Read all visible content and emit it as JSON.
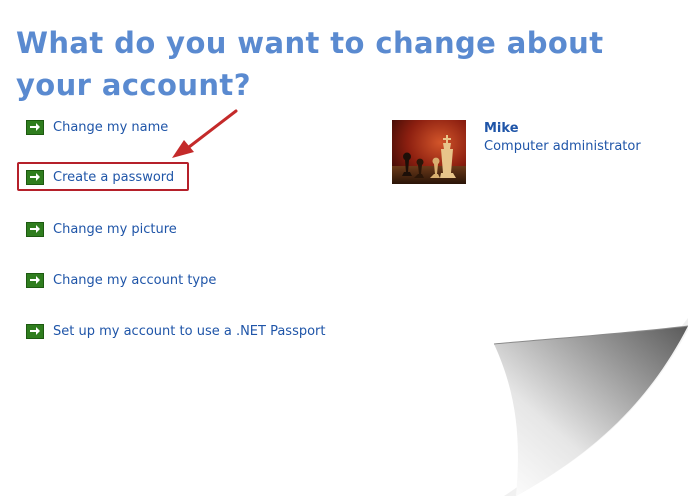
{
  "page": {
    "title": "What do you want to change about your account?"
  },
  "tasks": [
    {
      "label": "Change my name"
    },
    {
      "label": "Create a password"
    },
    {
      "label": "Change my picture"
    },
    {
      "label": "Change my account type"
    },
    {
      "label": "Set up my account to use a .NET Passport"
    }
  ],
  "user": {
    "name": "Mike",
    "role": "Computer administrator",
    "picture": "chess-pieces-picture"
  },
  "colors": {
    "title": "#5a8ad0",
    "link": "#1f55a8",
    "task_arrow": "#2f7d1e",
    "highlight": "#b5202a"
  },
  "icons": {
    "task": "green-arrow-icon",
    "pointer": "red-pointer-arrow-icon"
  }
}
